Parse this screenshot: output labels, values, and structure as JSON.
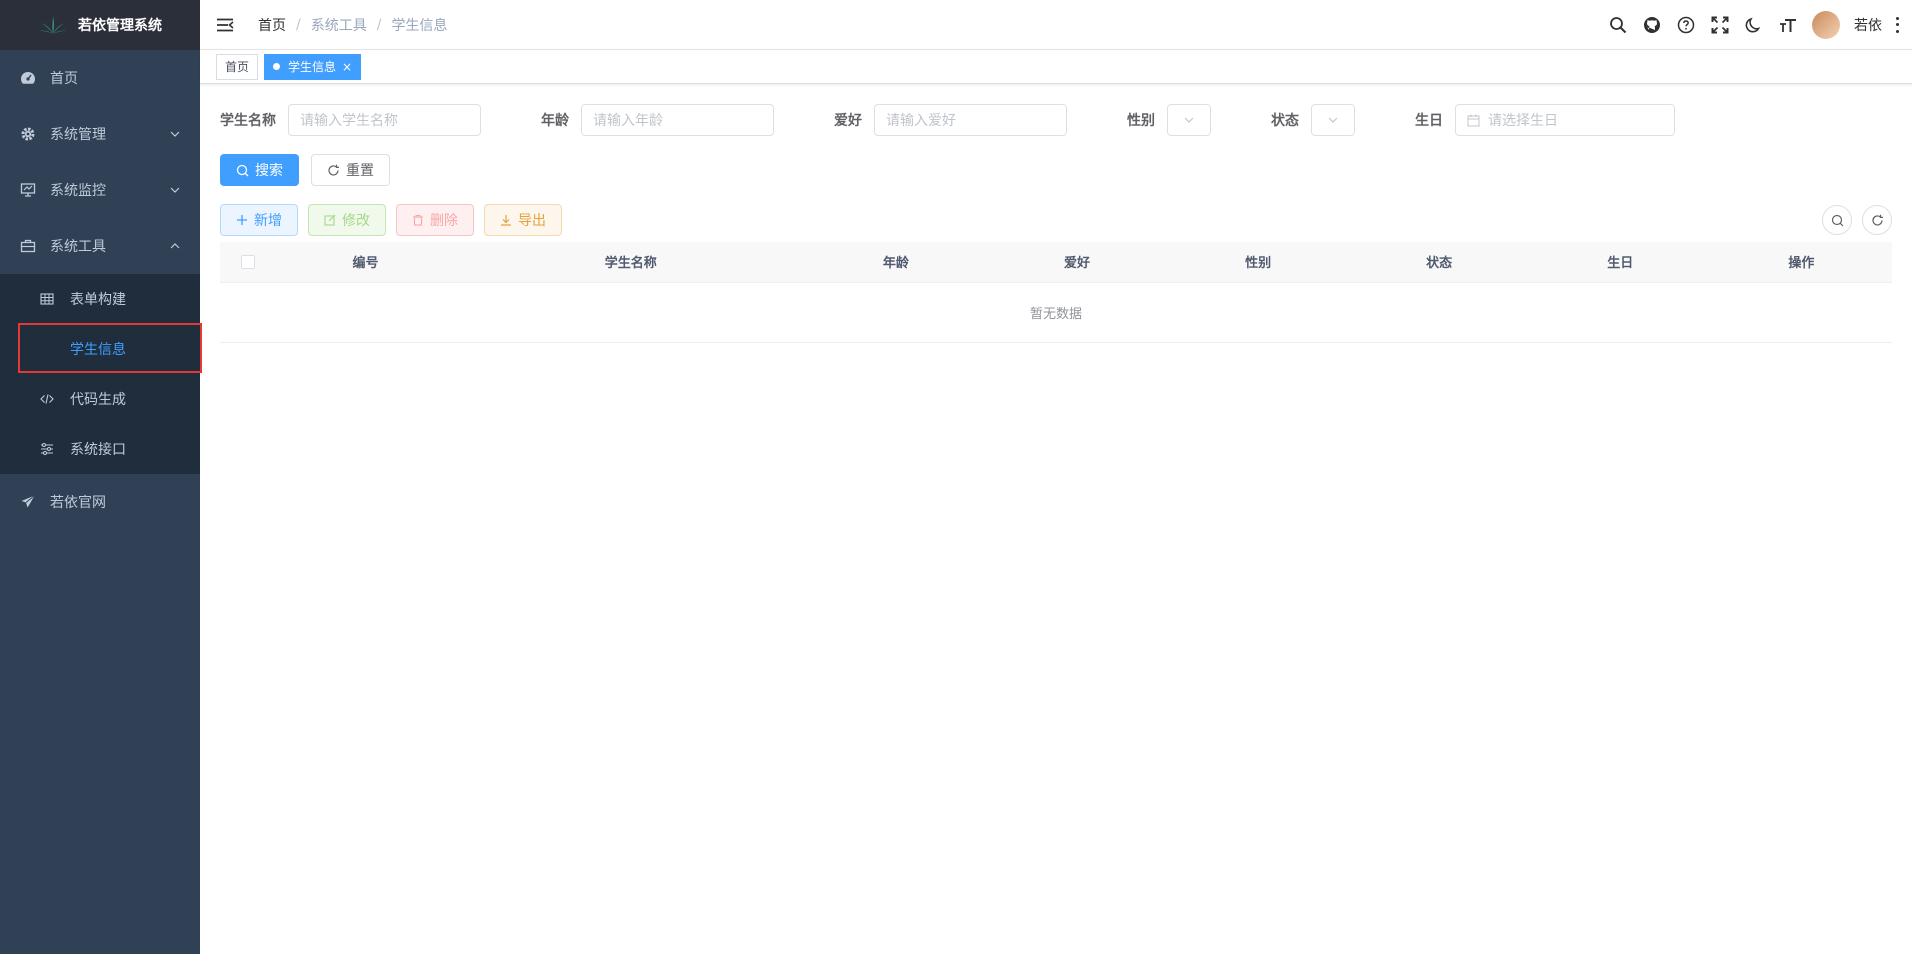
{
  "sidebar": {
    "logo_title": "若依管理系统",
    "items": [
      {
        "label": "首页",
        "icon": "dashboard-icon"
      },
      {
        "label": "系统管理",
        "icon": "gear-icon"
      },
      {
        "label": "系统监控",
        "icon": "monitor-icon"
      },
      {
        "label": "系统工具",
        "icon": "toolbox-icon"
      },
      {
        "label": "若依官网",
        "icon": "send-icon"
      }
    ],
    "tool_subitems": [
      {
        "label": "表单构建",
        "icon": "table-icon"
      },
      {
        "label": "学生信息",
        "icon": ""
      },
      {
        "label": "代码生成",
        "icon": "code-icon"
      },
      {
        "label": "系统接口",
        "icon": "sliders-icon"
      }
    ]
  },
  "navbar": {
    "breadcrumb": [
      "首页",
      "系统工具",
      "学生信息"
    ],
    "user_name": "若依"
  },
  "tags": {
    "home": "首页",
    "active": "学生信息"
  },
  "search_form": {
    "student_name_label": "学生名称",
    "student_name_placeholder": "请输入学生名称",
    "age_label": "年龄",
    "age_placeholder": "请输入年龄",
    "hobby_label": "爱好",
    "hobby_placeholder": "请输入爱好",
    "gender_label": "性别",
    "status_label": "状态",
    "birthday_label": "生日",
    "birthday_placeholder": "请选择生日",
    "search_button": "搜索",
    "reset_button": "重置"
  },
  "toolbar": {
    "add": "新增",
    "edit": "修改",
    "delete": "删除",
    "export": "导出"
  },
  "table": {
    "columns": [
      "编号",
      "学生名称",
      "年龄",
      "爱好",
      "性别",
      "状态",
      "生日",
      "操作"
    ],
    "empty_text": "暂无数据"
  },
  "colors": {
    "sidebar_bg": "#304156",
    "submenu_bg": "#1f2d3d",
    "primary": "#409eff",
    "highlight_box": "#e53935"
  }
}
